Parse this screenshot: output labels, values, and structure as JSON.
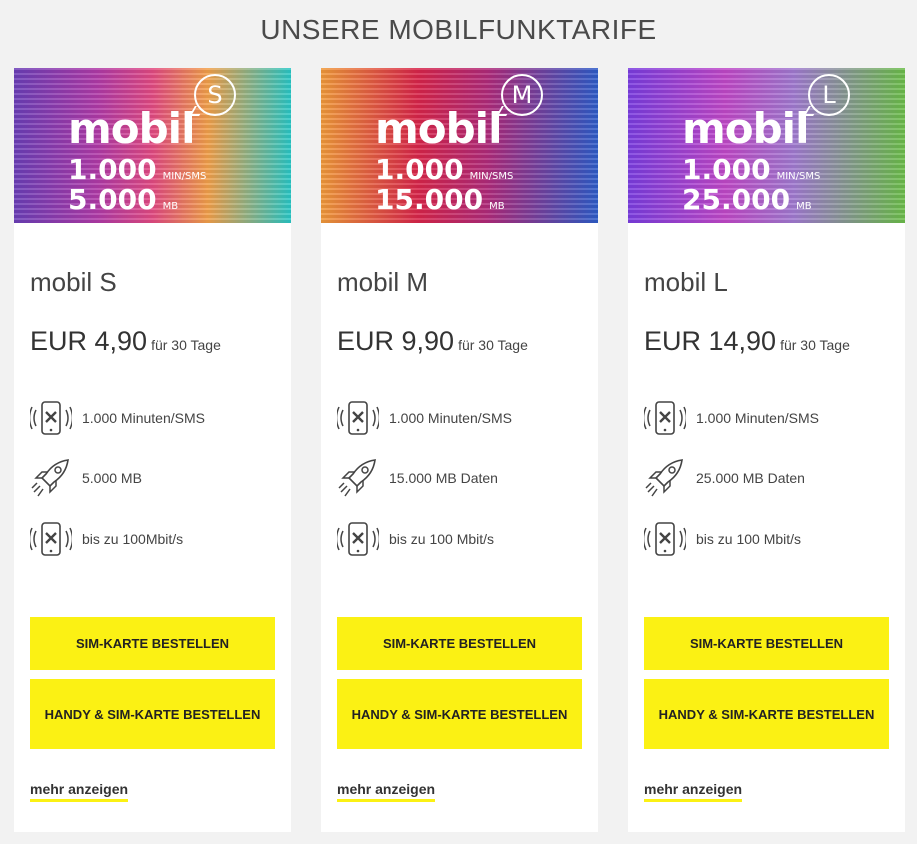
{
  "page": {
    "title": "UNSERE MOBILFUNKTARIFE"
  },
  "colors": {
    "accent": "#fbf114",
    "background": "#f2f2f2",
    "card": "#ffffff"
  },
  "cards": [
    {
      "banner": {
        "brand": "mobil",
        "size": "S",
        "minutes": "1.000",
        "minutes_unit": "MIN/SMS",
        "data": "5.000",
        "data_unit": "MB"
      },
      "name": "mobil S",
      "price": "EUR 4,90",
      "period": "für 30 Tage",
      "features": [
        {
          "icon": "phone-signal-icon",
          "text": "1.000 Minuten/SMS"
        },
        {
          "icon": "rocket-icon",
          "text": "5.000 MB"
        },
        {
          "icon": "phone-signal-icon",
          "text": "bis zu 100Mbit/s"
        }
      ],
      "buttons": {
        "sim": "SIM-KARTE BESTELLEN",
        "handy": "HANDY & SIM-KARTE BESTELLEN"
      },
      "more": "mehr anzeigen"
    },
    {
      "banner": {
        "brand": "mobil",
        "size": "M",
        "minutes": "1.000",
        "minutes_unit": "MIN/SMS",
        "data": "15.000",
        "data_unit": "MB"
      },
      "name": "mobil M",
      "price": "EUR 9,90",
      "period": "für 30 Tage",
      "features": [
        {
          "icon": "phone-signal-icon",
          "text": "1.000 Minuten/SMS"
        },
        {
          "icon": "rocket-icon",
          "text": "15.000 MB Daten"
        },
        {
          "icon": "phone-signal-icon",
          "text": "bis zu 100 Mbit/s"
        }
      ],
      "buttons": {
        "sim": "SIM-KARTE BESTELLEN",
        "handy": "HANDY & SIM-KARTE BESTELLEN"
      },
      "more": "mehr anzeigen"
    },
    {
      "banner": {
        "brand": "mobil",
        "size": "L",
        "minutes": "1.000",
        "minutes_unit": "MIN/SMS",
        "data": "25.000",
        "data_unit": "MB"
      },
      "name": "mobil L",
      "price": "EUR 14,90",
      "period": "für 30 Tage",
      "features": [
        {
          "icon": "phone-signal-icon",
          "text": "1.000 Minuten/SMS"
        },
        {
          "icon": "rocket-icon",
          "text": "25.000 MB Daten"
        },
        {
          "icon": "phone-signal-icon",
          "text": "bis zu 100 Mbit/s"
        }
      ],
      "buttons": {
        "sim": "SIM-KARTE BESTELLEN",
        "handy": "HANDY & SIM-KARTE BESTELLEN"
      },
      "more": "mehr anzeigen"
    }
  ]
}
